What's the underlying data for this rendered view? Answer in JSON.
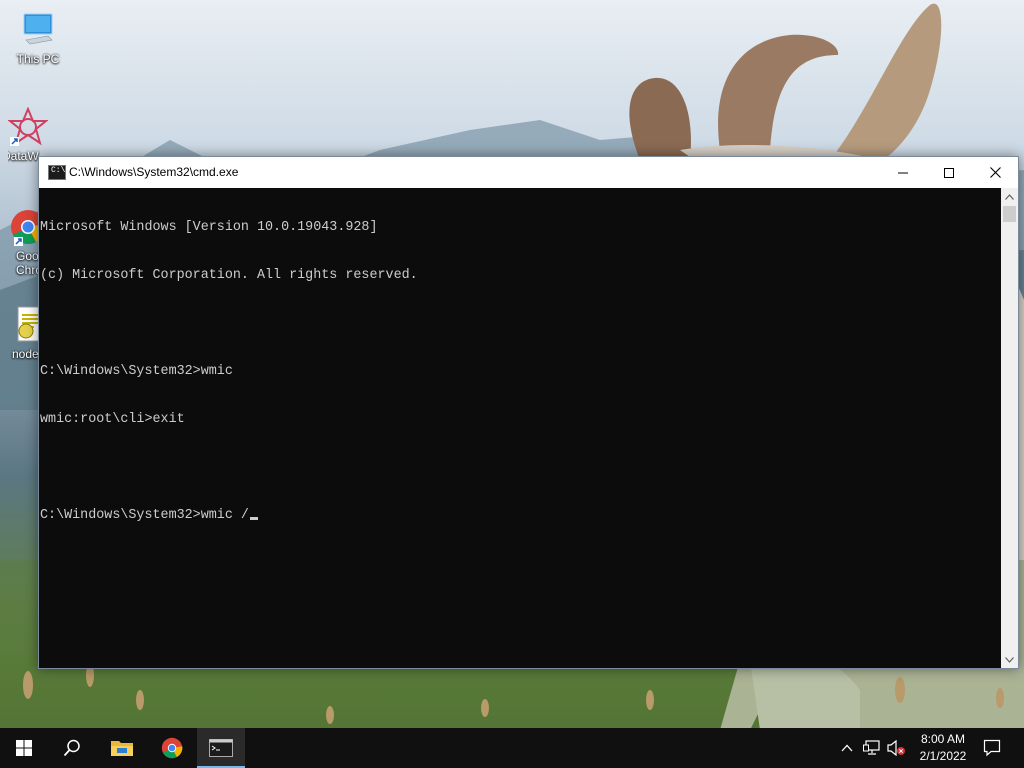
{
  "desktop": {
    "icons": [
      {
        "label": "This PC",
        "icon": "this-pc-icon"
      },
      {
        "label": "DataW",
        "icon": "datawrapper-icon"
      },
      {
        "label": "Goo\nChro",
        "icon": "chrome-icon"
      },
      {
        "label": "node",
        "icon": "node-script-icon"
      }
    ]
  },
  "window": {
    "title": "C:\\Windows\\System32\\cmd.exe",
    "minimize_icon": "minimize-icon",
    "maximize_icon": "maximize-icon",
    "close_icon": "close-icon"
  },
  "console": {
    "lines": [
      "Microsoft Windows [Version 10.0.19043.928]",
      "(c) Microsoft Corporation. All rights reserved.",
      "",
      "C:\\Windows\\System32>wmic",
      "wmic:root\\cli>exit",
      "",
      "C:\\Windows\\System32>wmic /"
    ],
    "colors": {
      "background": "#0c0c0c",
      "text": "#cccccc"
    }
  },
  "taskbar": {
    "buttons": [
      {
        "name": "start",
        "icon": "windows-start-icon"
      },
      {
        "name": "search",
        "icon": "search-icon"
      },
      {
        "name": "file-explorer",
        "icon": "folder-icon"
      },
      {
        "name": "chrome",
        "icon": "chrome-icon"
      },
      {
        "name": "command-prompt",
        "icon": "cmd-icon",
        "active": true
      }
    ],
    "tray": {
      "icons": [
        "chevron-up-icon",
        "network-icon",
        "volume-muted-icon"
      ],
      "time": "8:00 AM",
      "date": "2/1/2022",
      "notification_icon": "notification-icon"
    },
    "accent": "#76b9ed"
  }
}
